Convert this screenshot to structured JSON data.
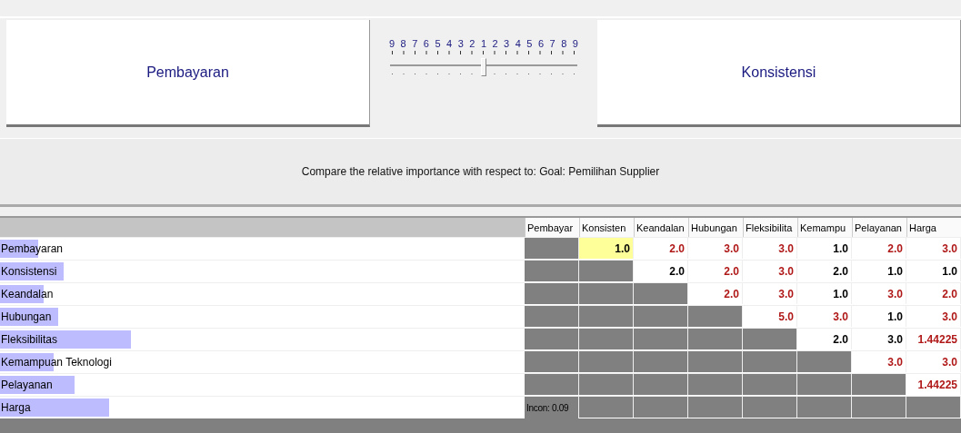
{
  "comparison": {
    "left": "Pembayaran",
    "right": "Konsistensi",
    "scale": [
      "9",
      "8",
      "7",
      "6",
      "5",
      "4",
      "3",
      "2",
      "1",
      "2",
      "3",
      "4",
      "5",
      "6",
      "7",
      "8",
      "9"
    ],
    "level": 0.5
  },
  "banner": "Compare the relative importance with respect to: Goal: Pemilihan Supplier",
  "table": {
    "columns": [
      "Pembayar",
      "Konsisten",
      "Keandalan",
      "Hubungan",
      "Fleksibilita",
      "Kemampu",
      "Pelayanan",
      "Harga"
    ],
    "rows": [
      {
        "label": "Pembayaran",
        "level": 0.073,
        "cells": [
          {
            "kind": "blank"
          },
          {
            "kind": "value",
            "text": "1.0",
            "inverted": false,
            "selected": true
          },
          {
            "kind": "value",
            "text": "2.0",
            "inverted": true,
            "selected": false
          },
          {
            "kind": "value",
            "text": "3.0",
            "inverted": true,
            "selected": false
          },
          {
            "kind": "value",
            "text": "3.0",
            "inverted": true,
            "selected": false
          },
          {
            "kind": "value",
            "text": "1.0",
            "inverted": false,
            "selected": false
          },
          {
            "kind": "value",
            "text": "2.0",
            "inverted": true,
            "selected": false
          },
          {
            "kind": "value",
            "text": "3.0",
            "inverted": true,
            "selected": false
          }
        ]
      },
      {
        "label": "Konsistensi",
        "level": 0.121,
        "cells": [
          {
            "kind": "blank"
          },
          {
            "kind": "blank"
          },
          {
            "kind": "value",
            "text": "2.0",
            "inverted": false,
            "selected": false
          },
          {
            "kind": "value",
            "text": "2.0",
            "inverted": true,
            "selected": false
          },
          {
            "kind": "value",
            "text": "3.0",
            "inverted": true,
            "selected": false
          },
          {
            "kind": "value",
            "text": "2.0",
            "inverted": false,
            "selected": false
          },
          {
            "kind": "value",
            "text": "1.0",
            "inverted": false,
            "selected": false
          },
          {
            "kind": "value",
            "text": "1.0",
            "inverted": false,
            "selected": false
          }
        ]
      },
      {
        "label": "Keandalan",
        "level": 0.083,
        "cells": [
          {
            "kind": "blank"
          },
          {
            "kind": "blank"
          },
          {
            "kind": "blank"
          },
          {
            "kind": "value",
            "text": "2.0",
            "inverted": true,
            "selected": false
          },
          {
            "kind": "value",
            "text": "3.0",
            "inverted": true,
            "selected": false
          },
          {
            "kind": "value",
            "text": "1.0",
            "inverted": false,
            "selected": false
          },
          {
            "kind": "value",
            "text": "3.0",
            "inverted": true,
            "selected": false
          },
          {
            "kind": "value",
            "text": "2.0",
            "inverted": true,
            "selected": false
          }
        ]
      },
      {
        "label": "Hubungan",
        "level": 0.111,
        "cells": [
          {
            "kind": "blank"
          },
          {
            "kind": "blank"
          },
          {
            "kind": "blank"
          },
          {
            "kind": "blank"
          },
          {
            "kind": "value",
            "text": "5.0",
            "inverted": true,
            "selected": false
          },
          {
            "kind": "value",
            "text": "3.0",
            "inverted": true,
            "selected": false
          },
          {
            "kind": "value",
            "text": "1.0",
            "inverted": false,
            "selected": false
          },
          {
            "kind": "value",
            "text": "3.0",
            "inverted": true,
            "selected": false
          }
        ]
      },
      {
        "label": "Fleksibilitas",
        "level": 0.25,
        "cells": [
          {
            "kind": "blank"
          },
          {
            "kind": "blank"
          },
          {
            "kind": "blank"
          },
          {
            "kind": "blank"
          },
          {
            "kind": "blank"
          },
          {
            "kind": "value",
            "text": "2.0",
            "inverted": false,
            "selected": false
          },
          {
            "kind": "value",
            "text": "3.0",
            "inverted": false,
            "selected": false
          },
          {
            "kind": "value",
            "text": "1.44225",
            "inverted": true,
            "selected": false
          }
        ]
      },
      {
        "label": "Kemampuan Teknologi",
        "level": 0.102,
        "cells": [
          {
            "kind": "blank"
          },
          {
            "kind": "blank"
          },
          {
            "kind": "blank"
          },
          {
            "kind": "blank"
          },
          {
            "kind": "blank"
          },
          {
            "kind": "blank"
          },
          {
            "kind": "value",
            "text": "3.0",
            "inverted": true,
            "selected": false
          },
          {
            "kind": "value",
            "text": "3.0",
            "inverted": true,
            "selected": false
          }
        ]
      },
      {
        "label": "Pelayanan",
        "level": 0.142,
        "cells": [
          {
            "kind": "blank"
          },
          {
            "kind": "blank"
          },
          {
            "kind": "blank"
          },
          {
            "kind": "blank"
          },
          {
            "kind": "blank"
          },
          {
            "kind": "blank"
          },
          {
            "kind": "blank"
          },
          {
            "kind": "value",
            "text": "1.44225",
            "inverted": true,
            "selected": false
          }
        ]
      },
      {
        "label": "Harga",
        "level": 0.208,
        "cells": [
          {
            "kind": "note",
            "text": "Incon: 0.09"
          },
          {
            "kind": "blank"
          },
          {
            "kind": "blank"
          },
          {
            "kind": "blank"
          },
          {
            "kind": "blank"
          },
          {
            "kind": "blank"
          },
          {
            "kind": "blank"
          },
          {
            "kind": "blank"
          }
        ]
      }
    ]
  }
}
